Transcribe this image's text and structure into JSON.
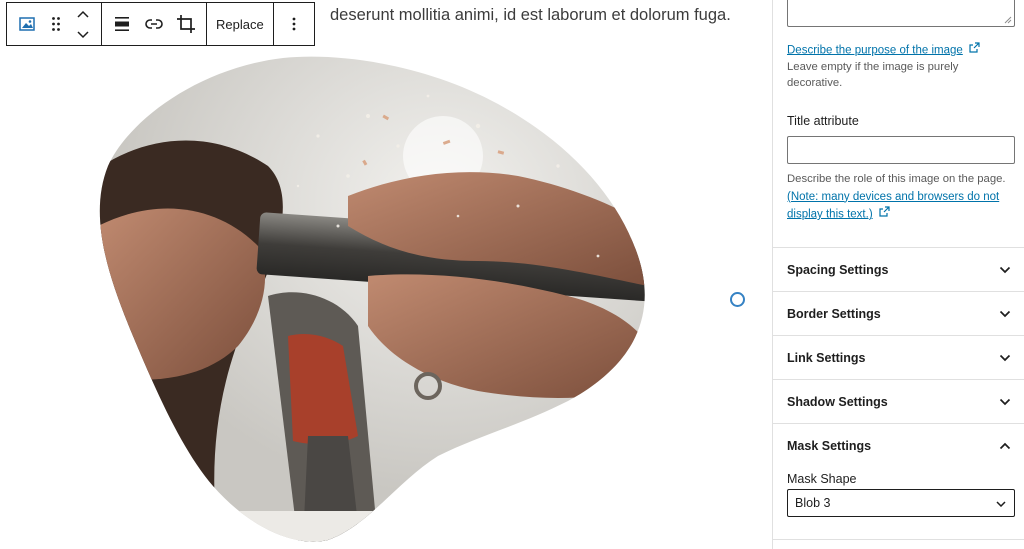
{
  "editor": {
    "paragraph_text": "deserunt mollitia animi, id est laborum et dolorum fuga.",
    "toolbar": {
      "replace_label": "Replace"
    }
  },
  "sidebar": {
    "alt": {
      "help_link": "Describe the purpose of the image",
      "help_text": "Leave empty if the image is purely decorative."
    },
    "title_attribute": {
      "label": "Title attribute",
      "value": "",
      "help_text": "Describe the role of this image on the page.",
      "help_link": "(Note: many devices and browsers do not display this text.)"
    },
    "panels": [
      {
        "title": "Spacing Settings",
        "expanded": false
      },
      {
        "title": "Border Settings",
        "expanded": false
      },
      {
        "title": "Link Settings",
        "expanded": false
      },
      {
        "title": "Shadow Settings",
        "expanded": false
      },
      {
        "title": "Mask Settings",
        "expanded": true
      }
    ],
    "mask": {
      "shape_label": "Mask Shape",
      "shape_value": "Blob 3"
    }
  },
  "colors": {
    "accent": "#0073aa",
    "handle": "#3582c4"
  },
  "icons": [
    "image-icon",
    "drag-handle-icon",
    "move-up-icon",
    "move-down-icon",
    "align-icon",
    "link-icon",
    "crop-icon",
    "more-options-icon",
    "external-link-icon",
    "chevron-down-icon",
    "chevron-up-icon"
  ]
}
